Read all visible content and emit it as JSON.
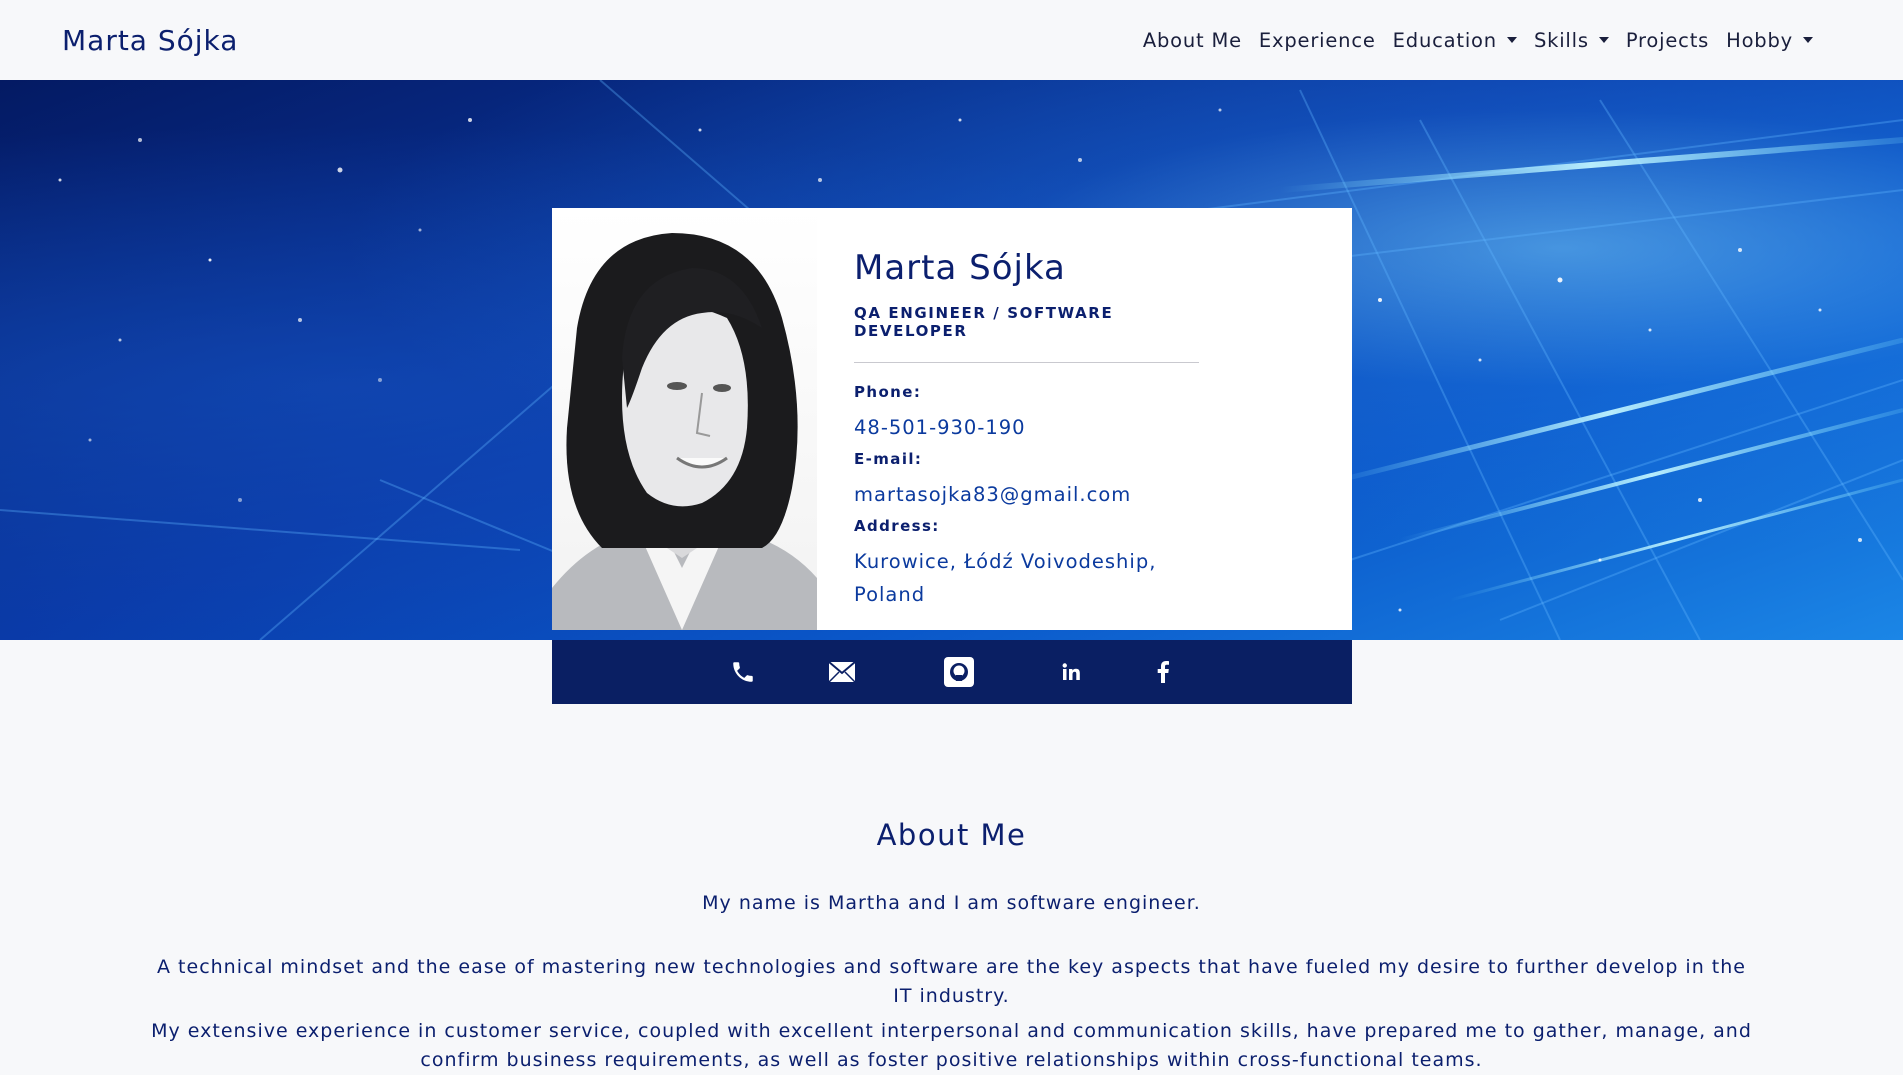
{
  "navbar": {
    "brand": "Marta Sójka",
    "items": [
      {
        "label": "About Me",
        "dropdown": false
      },
      {
        "label": "Experience",
        "dropdown": false
      },
      {
        "label": "Education",
        "dropdown": true
      },
      {
        "label": "Skills",
        "dropdown": true
      },
      {
        "label": "Projects",
        "dropdown": false
      },
      {
        "label": "Hobby",
        "dropdown": true
      }
    ]
  },
  "profile": {
    "name": "Marta Sójka",
    "role": "QA ENGINEER / SOFTWARE DEVELOPER",
    "phone_label": "Phone:",
    "phone": "48-501-930-190",
    "email_label": "E-mail:",
    "email": "martasojka83@gmail.com",
    "address_label": "Address:",
    "address": "Kurowice, Łódź Voivodeship, Poland"
  },
  "social": {
    "icons": [
      "phone-icon",
      "mail-icon",
      "github-icon",
      "linkedin-icon",
      "facebook-icon"
    ]
  },
  "about": {
    "title": "About Me",
    "paragraphs": [
      "My name is Martha and I am software engineer.",
      "A technical mindset and the ease of mastering new technologies and software are the key aspects that have fueled my desire to further develop in the IT industry.",
      "My extensive experience in customer service, coupled with excellent interpersonal and communication skills, have prepared me to gather, manage, and confirm business requirements, as well as foster positive relationships within cross-functional teams."
    ]
  },
  "colors": {
    "accent": "#0b1f6e",
    "social_bar": "#0a1f63",
    "background": "#f7f8fa"
  }
}
